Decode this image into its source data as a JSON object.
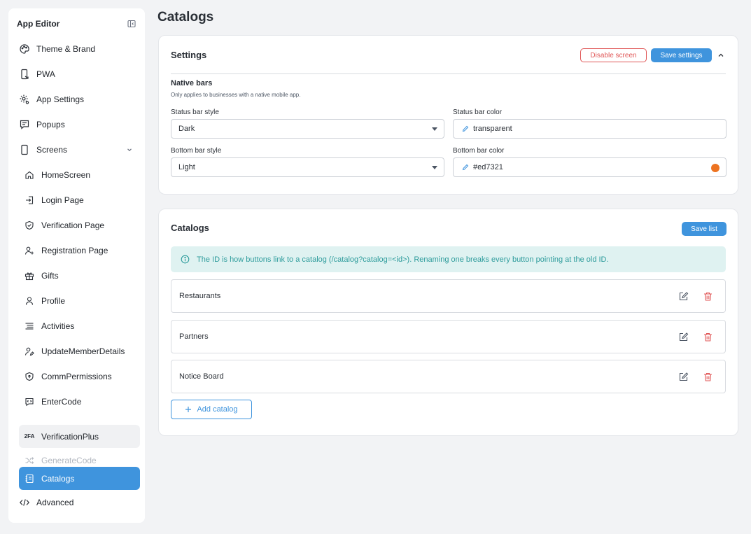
{
  "sidebar": {
    "title": "App Editor",
    "items": [
      {
        "label": "Theme & Brand",
        "icon": "palette-icon"
      },
      {
        "label": "PWA",
        "icon": "phone-arrow-icon"
      },
      {
        "label": "App Settings",
        "icon": "gear-cog-icon"
      },
      {
        "label": "Popups",
        "icon": "chat-square-icon"
      },
      {
        "label": "Screens",
        "icon": "smartphone-icon"
      }
    ],
    "screens": [
      {
        "label": "HomeScreen",
        "icon": "home-icon"
      },
      {
        "label": "Login Page",
        "icon": "login-icon"
      },
      {
        "label": "Verification Page",
        "icon": "shield-check-icon"
      },
      {
        "label": "Registration Page",
        "icon": "user-plus-icon"
      },
      {
        "label": "Gifts",
        "icon": "gift-icon"
      },
      {
        "label": "Profile",
        "icon": "user-icon"
      },
      {
        "label": "Activities",
        "icon": "list-icon"
      },
      {
        "label": "UpdateMemberDetails",
        "icon": "user-edit-icon"
      },
      {
        "label": "CommPermissions",
        "icon": "shield-lock-icon"
      },
      {
        "label": "EnterCode",
        "icon": "message-code-icon"
      },
      {
        "label": "VerificationPlus",
        "icon": "two-factor-icon",
        "badge": "2FA"
      },
      {
        "label": "GenerateCode",
        "icon": "shuffle-icon"
      },
      {
        "label": "Catalogs",
        "icon": "notebook-icon"
      }
    ],
    "advanced": {
      "label": "Advanced",
      "icon": "code-icon"
    }
  },
  "page": {
    "title": "Catalogs"
  },
  "settings": {
    "title": "Settings",
    "disable_label": "Disable screen",
    "save_label": "Save settings",
    "section_title": "Native bars",
    "section_desc": "Only applies to businesses with a native mobile app.",
    "status_style": {
      "label": "Status bar style",
      "value": "Dark"
    },
    "status_color": {
      "label": "Status bar color",
      "value": "transparent"
    },
    "bottom_style": {
      "label": "Bottom bar style",
      "value": "Light"
    },
    "bottom_color": {
      "label": "Bottom bar color",
      "value": "#ed7321",
      "swatch": "#ed7321"
    }
  },
  "catalogs": {
    "title": "Catalogs",
    "save_label": "Save list",
    "info": "The ID is how buttons link to a catalog (/catalog?catalog=<id>). Renaming one breaks every button pointing at the old ID.",
    "rows": [
      {
        "name": "Restaurants"
      },
      {
        "name": "Partners"
      },
      {
        "name": "Notice Board"
      }
    ],
    "add_label": "Add catalog"
  },
  "colors": {
    "accent": "#3f94dd",
    "danger": "#e05656",
    "info_text": "#2e9c9c",
    "info_bg": "#dff2f1"
  }
}
